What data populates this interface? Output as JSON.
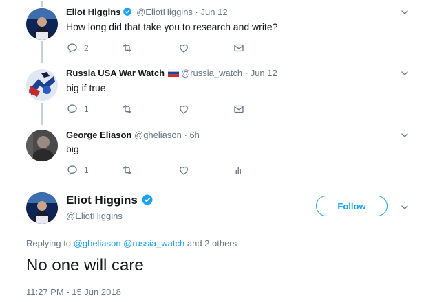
{
  "tweets": [
    {
      "name": "Eliot Higgins",
      "handle": "@EliotHiggins",
      "separator": "·",
      "time": "Jun 12",
      "text": "How long did that take you to research and write?",
      "replies": "2",
      "verified": true
    },
    {
      "name": "Russia USA War Watch",
      "handle": "@russia_watch",
      "separator": "·",
      "time": "Jun 12",
      "text": "big if true",
      "replies": "1",
      "flag": "russia-flag"
    },
    {
      "name": "George Eliason",
      "handle": "@gheliason",
      "separator": "·",
      "time": "6h",
      "text": "big",
      "replies": "1"
    }
  ],
  "main_tweet": {
    "name": "Eliot Higgins",
    "handle": "@EliotHiggins",
    "follow_label": "Follow",
    "replying_prefix": "Replying to",
    "replying_to": [
      "@gheliason",
      "@russia_watch"
    ],
    "replying_suffix": "and 2 others",
    "text": "No one will care",
    "timestamp": "11:27 PM - 15 Jun 2018"
  },
  "icons": {
    "reply": "reply-icon",
    "retweet": "retweet-icon",
    "like": "like-icon",
    "dm": "envelope-icon",
    "analytics": "analytics-icon",
    "more": "chevron-down-icon",
    "verified": "verified-badge-icon"
  },
  "colors": {
    "accent": "#1da1f2",
    "secondary_text": "#657786",
    "primary_text": "#14171a",
    "thread_line": "#c4cfd6"
  }
}
